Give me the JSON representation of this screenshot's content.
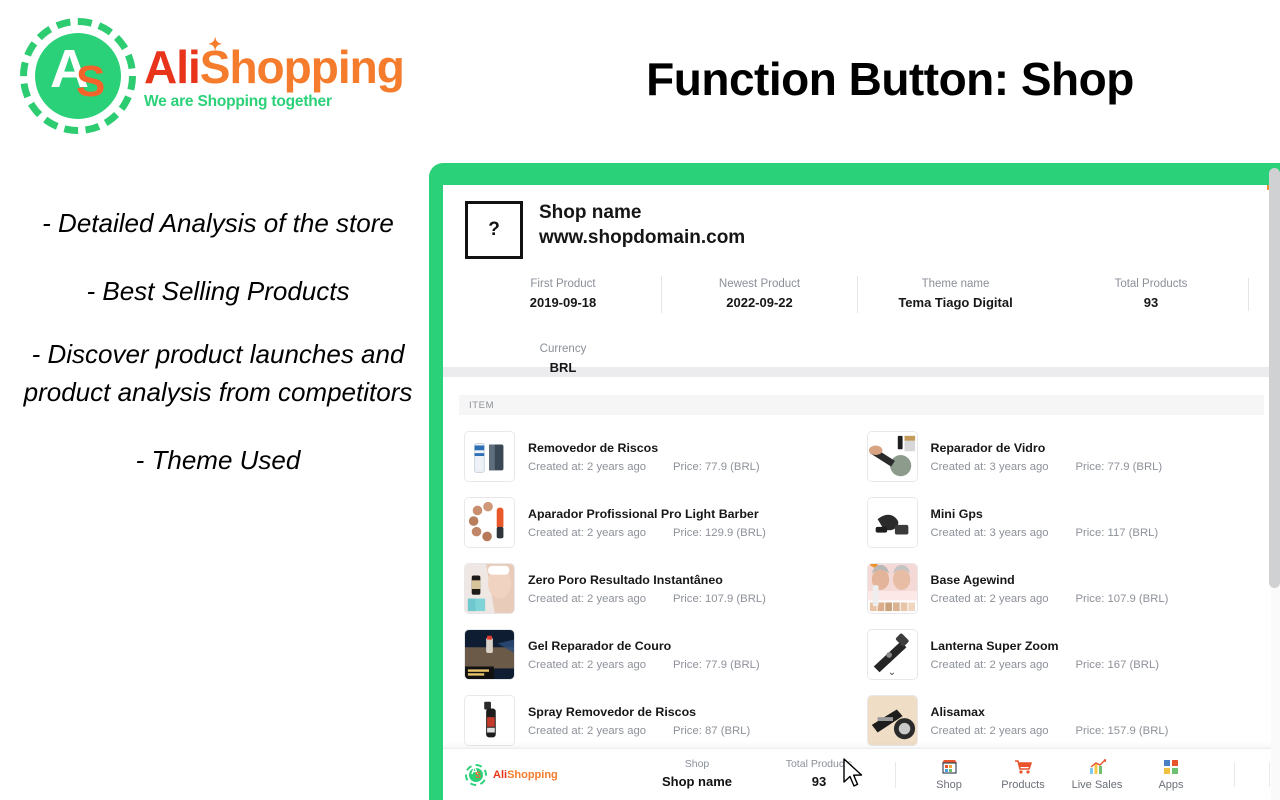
{
  "brand": {
    "logo_a": "A",
    "logo_s": "S",
    "name_part1": "Ali",
    "name_part2": "Shopping",
    "tagline": "We are Shopping together",
    "green": "#2bd179",
    "orange": "#f47c2c",
    "red": "#e8341a"
  },
  "slide": {
    "title": "Function Button: Shop",
    "bullets": [
      "- Detailed Analysis of the store",
      "- Best Selling Products",
      "- Discover product launches and product analysis from competitors",
      "- Theme Used"
    ]
  },
  "app": {
    "shop": {
      "logo_placeholder": "?",
      "name": "Shop name",
      "domain": "www.shopdomain.com"
    },
    "stats": [
      {
        "key": "First Product",
        "value": "2019-09-18"
      },
      {
        "key": "Newest Product",
        "value": "2022-09-22"
      },
      {
        "key": "Theme name",
        "value": "Tema Tiago Digital"
      },
      {
        "key": "Total Products",
        "value": "93"
      },
      {
        "key": "Currency",
        "value": "BRL"
      }
    ],
    "list_header": "ITEM",
    "products_left": [
      {
        "title": "Removedor de Riscos",
        "created": "Created at: 2 years ago",
        "price": "Price: 77.9 (BRL)"
      },
      {
        "title": "Aparador Profissional Pro Light Barber",
        "created": "Created at: 2 years ago",
        "price": "Price: 129.9 (BRL)"
      },
      {
        "title": "Zero Poro Resultado Instantâneo",
        "created": "Created at: 2 years ago",
        "price": "Price: 107.9 (BRL)"
      },
      {
        "title": "Gel Reparador de Couro",
        "created": "Created at: 2 years ago",
        "price": "Price: 77.9 (BRL)"
      },
      {
        "title": "Spray Removedor de Riscos",
        "created": "Created at: 2 years ago",
        "price": "Price: 87 (BRL)"
      }
    ],
    "products_right": [
      {
        "title": "Reparador de Vidro",
        "created": "Created at: 3 years ago",
        "price": "Price: 77.9 (BRL)"
      },
      {
        "title": "Mini Gps",
        "created": "Created at: 3 years ago",
        "price": "Price: 117 (BRL)"
      },
      {
        "title": "Base Agewind",
        "created": "Created at: 2 years ago",
        "price": "Price: 107.9 (BRL)"
      },
      {
        "title": "Lanterna Super Zoom",
        "created": "Created at: 2 years ago",
        "price": "Price: 167 (BRL)"
      },
      {
        "title": "Alisamax",
        "created": "Created at: 2 years ago",
        "price": "Price: 157.9 (BRL)"
      }
    ],
    "bottom": {
      "shop_key": "Shop",
      "shop_value": "Shop name",
      "total_key": "Total Products",
      "total_value": "93",
      "nav": [
        {
          "label": "Shop",
          "icon": "store-icon"
        },
        {
          "label": "Products",
          "icon": "cart-icon"
        },
        {
          "label": "Live Sales",
          "icon": "chart-icon"
        },
        {
          "label": "Apps",
          "icon": "apps-icon"
        }
      ]
    }
  }
}
